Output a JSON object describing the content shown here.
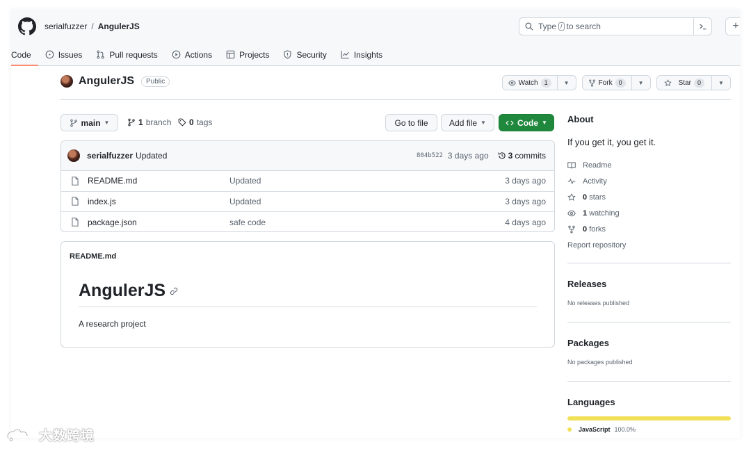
{
  "header": {
    "owner": "serialfuzzer",
    "separator": "/",
    "repo": "AngulerJS",
    "search_prefix": "Type",
    "search_key": "/",
    "search_suffix": "to search",
    "plus_label": "+"
  },
  "tabs": [
    {
      "label": "Code",
      "icon": "code-icon"
    },
    {
      "label": "Issues",
      "icon": "issue-icon"
    },
    {
      "label": "Pull requests",
      "icon": "pull-request-icon"
    },
    {
      "label": "Actions",
      "icon": "play-icon"
    },
    {
      "label": "Projects",
      "icon": "table-icon"
    },
    {
      "label": "Security",
      "icon": "shield-icon"
    },
    {
      "label": "Insights",
      "icon": "graph-icon"
    }
  ],
  "repo": {
    "title": "AngulerJS",
    "visibility": "Public",
    "watch_label": "Watch",
    "watch_count": "1",
    "fork_label": "Fork",
    "fork_count": "0",
    "star_label": "Star",
    "star_count": "0"
  },
  "branch_bar": {
    "branch_name": "main",
    "branch_count": "1",
    "branch_word": "branch",
    "tag_count": "0",
    "tag_word": "tags",
    "go_to_file": "Go to file",
    "add_file": "Add file",
    "code_button": "Code"
  },
  "latest_commit": {
    "author": "serialfuzzer",
    "message": "Updated",
    "sha": "804b522",
    "time": "3 days ago",
    "commit_count": "3",
    "commit_word": "commits"
  },
  "files": [
    {
      "name": "README.md",
      "message": "Updated",
      "date": "3 days ago"
    },
    {
      "name": "index.js",
      "message": "Updated",
      "date": "3 days ago"
    },
    {
      "name": "package.json",
      "message": "safe code",
      "date": "4 days ago"
    }
  ],
  "readme": {
    "filename": "README.md",
    "heading": "AngulerJS",
    "body": "A research project"
  },
  "sidebar": {
    "about_title": "About",
    "about_desc": "If you get it, you get it.",
    "readme_link": "Readme",
    "activity_link": "Activity",
    "stars_count": "0",
    "stars_word": "stars",
    "watching_count": "1",
    "watching_word": "watching",
    "forks_count": "0",
    "forks_word": "forks",
    "report": "Report repository",
    "releases_title": "Releases",
    "releases_note": "No releases published",
    "packages_title": "Packages",
    "packages_note": "No packages published",
    "languages_title": "Languages",
    "language_name": "JavaScript",
    "language_pct": "100.0%",
    "language_color": "#f1e05a"
  },
  "watermark": {
    "text": "大数跨境"
  },
  "colors": {
    "accent_green": "#1f883d",
    "tab_underline": "#fd8c73"
  }
}
